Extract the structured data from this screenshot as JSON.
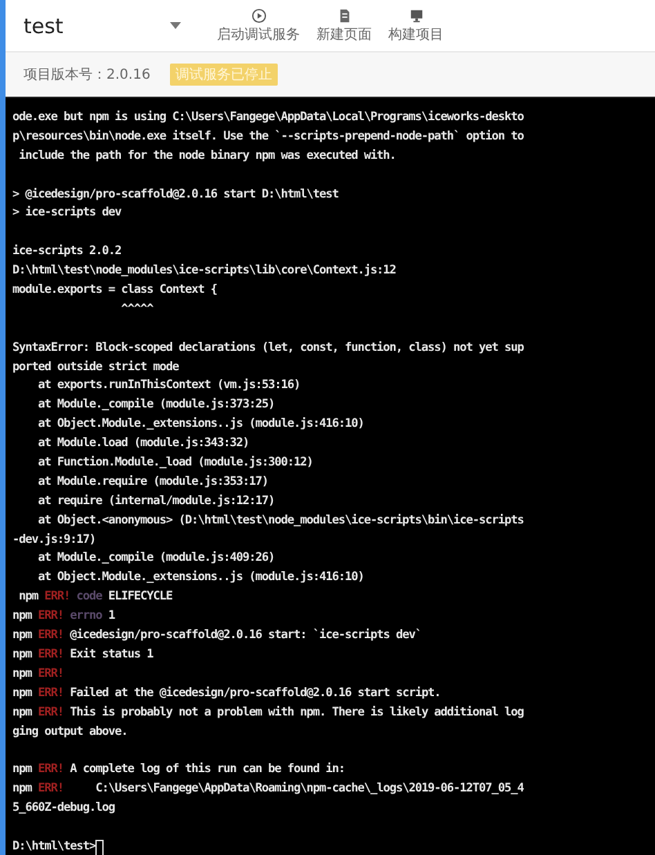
{
  "header": {
    "title": "test",
    "toolbar": [
      {
        "label": "启动调试服务"
      },
      {
        "label": "新建页面"
      },
      {
        "label": "构建项目"
      }
    ]
  },
  "info_bar": {
    "version_label": "项目版本号：2.0.16",
    "status_badge": "调试服务已停止"
  },
  "terminal": {
    "lines": [
      {
        "kind": "text",
        "segments": [
          {
            "kind": "normal",
            "text": "ode.exe but npm is using C:\\Users\\Fangege\\AppData\\Local\\Programs\\iceworks-deskto"
          }
        ]
      },
      {
        "kind": "text",
        "segments": [
          {
            "kind": "normal",
            "text": "p\\resources\\bin\\node.exe itself. Use the `--scripts-prepend-node-path` option to"
          }
        ]
      },
      {
        "kind": "text",
        "segments": [
          {
            "kind": "normal",
            "text": " include the path for the node binary npm was executed with."
          }
        ]
      },
      {
        "kind": "gap"
      },
      {
        "kind": "text",
        "segments": [
          {
            "kind": "normal",
            "text": "> @icedesign/pro-scaffold@2.0.16 start D:\\html\\test"
          }
        ]
      },
      {
        "kind": "text",
        "segments": [
          {
            "kind": "normal",
            "text": "> ice-scripts dev"
          }
        ]
      },
      {
        "kind": "gap"
      },
      {
        "kind": "text",
        "segments": [
          {
            "kind": "normal",
            "text": "ice-scripts 2.0.2"
          }
        ]
      },
      {
        "kind": "text",
        "segments": [
          {
            "kind": "normal",
            "text": "D:\\html\\test\\node_modules\\ice-scripts\\lib\\core\\Context.js:12"
          }
        ]
      },
      {
        "kind": "text",
        "segments": [
          {
            "kind": "normal",
            "text": "module.exports = class Context {"
          }
        ]
      },
      {
        "kind": "text",
        "segments": [
          {
            "kind": "normal",
            "text": "                 ^^^^^"
          }
        ]
      },
      {
        "kind": "gap"
      },
      {
        "kind": "text",
        "segments": [
          {
            "kind": "normal",
            "text": "SyntaxError: Block-scoped declarations (let, const, function, class) not yet sup"
          }
        ]
      },
      {
        "kind": "text",
        "segments": [
          {
            "kind": "normal",
            "text": "ported outside strict mode"
          }
        ]
      },
      {
        "kind": "text",
        "segments": [
          {
            "kind": "normal",
            "text": "    at exports.runInThisContext (vm.js:53:16)"
          }
        ]
      },
      {
        "kind": "text",
        "segments": [
          {
            "kind": "normal",
            "text": "    at Module._compile (module.js:373:25)"
          }
        ]
      },
      {
        "kind": "text",
        "segments": [
          {
            "kind": "normal",
            "text": "    at Object.Module._extensions..js (module.js:416:10)"
          }
        ]
      },
      {
        "kind": "text",
        "segments": [
          {
            "kind": "normal",
            "text": "    at Module.load (module.js:343:32)"
          }
        ]
      },
      {
        "kind": "text",
        "segments": [
          {
            "kind": "normal",
            "text": "    at Function.Module._load (module.js:300:12)"
          }
        ]
      },
      {
        "kind": "text",
        "segments": [
          {
            "kind": "normal",
            "text": "    at Module.require (module.js:353:17)"
          }
        ]
      },
      {
        "kind": "text",
        "segments": [
          {
            "kind": "normal",
            "text": "    at require (internal/module.js:12:17)"
          }
        ]
      },
      {
        "kind": "text",
        "segments": [
          {
            "kind": "normal",
            "text": "    at Object.<anonymous> (D:\\html\\test\\node_modules\\ice-scripts\\bin\\ice-scripts"
          }
        ]
      },
      {
        "kind": "text",
        "segments": [
          {
            "kind": "normal",
            "text": "-dev.js:9:17)"
          }
        ]
      },
      {
        "kind": "text",
        "segments": [
          {
            "kind": "normal",
            "text": "    at Module._compile (module.js:409:26)"
          }
        ]
      },
      {
        "kind": "text",
        "segments": [
          {
            "kind": "normal",
            "text": "    at Object.Module._extensions..js (module.js:416:10)"
          }
        ]
      },
      {
        "kind": "text",
        "segments": [
          {
            "kind": "normal",
            "text": " npm "
          },
          {
            "kind": "error",
            "text": "ERR!"
          },
          {
            "kind": "dim",
            "text": " code"
          },
          {
            "kind": "normal",
            "text": " ELIFECYCLE"
          }
        ]
      },
      {
        "kind": "text",
        "segments": [
          {
            "kind": "normal",
            "text": "npm "
          },
          {
            "kind": "error",
            "text": "ERR!"
          },
          {
            "kind": "dim",
            "text": " errno"
          },
          {
            "kind": "normal",
            "text": " 1"
          }
        ]
      },
      {
        "kind": "text",
        "segments": [
          {
            "kind": "normal",
            "text": "npm "
          },
          {
            "kind": "error",
            "text": "ERR!"
          },
          {
            "kind": "normal",
            "text": " @icedesign/pro-scaffold@2.0.16 start: `ice-scripts dev`"
          }
        ]
      },
      {
        "kind": "text",
        "segments": [
          {
            "kind": "normal",
            "text": "npm "
          },
          {
            "kind": "error",
            "text": "ERR!"
          },
          {
            "kind": "normal",
            "text": " Exit status 1"
          }
        ]
      },
      {
        "kind": "text",
        "segments": [
          {
            "kind": "normal",
            "text": "npm "
          },
          {
            "kind": "error",
            "text": "ERR!"
          }
        ]
      },
      {
        "kind": "text",
        "segments": [
          {
            "kind": "normal",
            "text": "npm "
          },
          {
            "kind": "error",
            "text": "ERR!"
          },
          {
            "kind": "normal",
            "text": " Failed at the @icedesign/pro-scaffold@2.0.16 start script."
          }
        ]
      },
      {
        "kind": "text",
        "segments": [
          {
            "kind": "normal",
            "text": "npm "
          },
          {
            "kind": "error",
            "text": "ERR!"
          },
          {
            "kind": "normal",
            "text": " This is probably not a problem with npm. There is likely additional log"
          }
        ]
      },
      {
        "kind": "text",
        "segments": [
          {
            "kind": "normal",
            "text": "ging output above."
          }
        ]
      },
      {
        "kind": "gap"
      },
      {
        "kind": "text",
        "segments": [
          {
            "kind": "normal",
            "text": "npm "
          },
          {
            "kind": "error",
            "text": "ERR!"
          },
          {
            "kind": "normal",
            "text": " A complete log of this run can be found in:"
          }
        ]
      },
      {
        "kind": "text",
        "segments": [
          {
            "kind": "normal",
            "text": "npm "
          },
          {
            "kind": "error",
            "text": "ERR!"
          },
          {
            "kind": "normal",
            "text": "     C:\\Users\\Fangege\\AppData\\Roaming\\npm-cache\\_logs\\2019-06-12T07_05_4"
          }
        ]
      },
      {
        "kind": "text",
        "segments": [
          {
            "kind": "normal",
            "text": "5_660Z-debug.log"
          }
        ]
      },
      {
        "kind": "gap"
      },
      {
        "kind": "prompt",
        "segments": [
          {
            "kind": "normal",
            "text": "D:\\html\\test>"
          }
        ]
      }
    ]
  }
}
